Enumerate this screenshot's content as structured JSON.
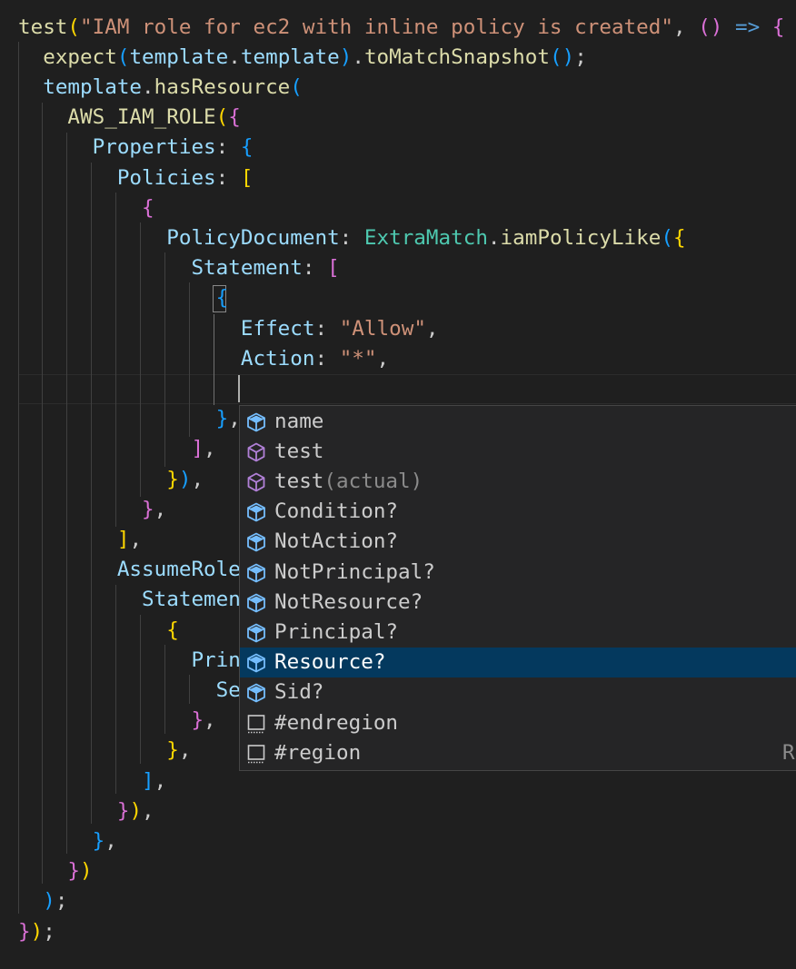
{
  "editor": {
    "lines": [
      [
        {
          "t": "test",
          "c": "fn"
        },
        {
          "t": "(",
          "c": "b1"
        },
        {
          "t": "\"IAM role for ec2 with inline policy is created\"",
          "c": "str"
        },
        {
          "t": ", ",
          "c": "pl"
        },
        {
          "t": "()",
          "c": "b2"
        },
        {
          "t": " ",
          "c": "pl"
        },
        {
          "t": "=>",
          "c": "kw"
        },
        {
          "t": " ",
          "c": "pl"
        },
        {
          "t": "{",
          "c": "b2"
        }
      ],
      [
        {
          "t": "  ",
          "c": "pl"
        },
        {
          "t": "expect",
          "c": "fn"
        },
        {
          "t": "(",
          "c": "b3"
        },
        {
          "t": "template",
          "c": "var"
        },
        {
          "t": ".",
          "c": "pl"
        },
        {
          "t": "template",
          "c": "var"
        },
        {
          "t": ")",
          "c": "b3"
        },
        {
          "t": ".",
          "c": "pl"
        },
        {
          "t": "toMatchSnapshot",
          "c": "fn"
        },
        {
          "t": "()",
          "c": "b3"
        },
        {
          "t": ";",
          "c": "pl"
        }
      ],
      [
        {
          "t": "  ",
          "c": "pl"
        },
        {
          "t": "template",
          "c": "var"
        },
        {
          "t": ".",
          "c": "pl"
        },
        {
          "t": "hasResource",
          "c": "fn"
        },
        {
          "t": "(",
          "c": "b3"
        }
      ],
      [
        {
          "t": "    ",
          "c": "pl"
        },
        {
          "t": "AWS_IAM_ROLE",
          "c": "fn"
        },
        {
          "t": "(",
          "c": "b1"
        },
        {
          "t": "{",
          "c": "b2"
        }
      ],
      [
        {
          "t": "      ",
          "c": "pl"
        },
        {
          "t": "Properties",
          "c": "prop"
        },
        {
          "t": ": ",
          "c": "pl"
        },
        {
          "t": "{",
          "c": "b3"
        }
      ],
      [
        {
          "t": "        ",
          "c": "pl"
        },
        {
          "t": "Policies",
          "c": "prop"
        },
        {
          "t": ": ",
          "c": "pl"
        },
        {
          "t": "[",
          "c": "b1"
        }
      ],
      [
        {
          "t": "          ",
          "c": "pl"
        },
        {
          "t": "{",
          "c": "b2"
        }
      ],
      [
        {
          "t": "            ",
          "c": "pl"
        },
        {
          "t": "PolicyDocument",
          "c": "prop"
        },
        {
          "t": ": ",
          "c": "pl"
        },
        {
          "t": "ExtraMatch",
          "c": "cls"
        },
        {
          "t": ".",
          "c": "pl"
        },
        {
          "t": "iamPolicyLike",
          "c": "fn"
        },
        {
          "t": "(",
          "c": "b3"
        },
        {
          "t": "{",
          "c": "b1"
        }
      ],
      [
        {
          "t": "              ",
          "c": "pl"
        },
        {
          "t": "Statement",
          "c": "prop"
        },
        {
          "t": ": ",
          "c": "pl"
        },
        {
          "t": "[",
          "c": "b2"
        }
      ],
      [
        {
          "t": "                ",
          "c": "pl"
        },
        {
          "t": "{",
          "c": "b3"
        }
      ],
      [
        {
          "t": "                  ",
          "c": "pl"
        },
        {
          "t": "Effect",
          "c": "prop"
        },
        {
          "t": ": ",
          "c": "pl"
        },
        {
          "t": "\"Allow\"",
          "c": "str"
        },
        {
          "t": ",",
          "c": "pl"
        }
      ],
      [
        {
          "t": "                  ",
          "c": "pl"
        },
        {
          "t": "Action",
          "c": "prop"
        },
        {
          "t": ": ",
          "c": "pl"
        },
        {
          "t": "\"*\"",
          "c": "str"
        },
        {
          "t": ",",
          "c": "pl"
        }
      ],
      [
        {
          "t": "",
          "c": "pl"
        }
      ],
      [
        {
          "t": "                ",
          "c": "pl"
        },
        {
          "t": "}",
          "c": "b3"
        },
        {
          "t": ",",
          "c": "pl"
        }
      ],
      [
        {
          "t": "              ",
          "c": "pl"
        },
        {
          "t": "]",
          "c": "b2"
        },
        {
          "t": ",",
          "c": "pl"
        }
      ],
      [
        {
          "t": "            ",
          "c": "pl"
        },
        {
          "t": "}",
          "c": "b1"
        },
        {
          "t": ")",
          "c": "b3"
        },
        {
          "t": ",",
          "c": "pl"
        }
      ],
      [
        {
          "t": "          ",
          "c": "pl"
        },
        {
          "t": "}",
          "c": "b2"
        },
        {
          "t": ",",
          "c": "pl"
        }
      ],
      [
        {
          "t": "        ",
          "c": "pl"
        },
        {
          "t": "]",
          "c": "b1"
        },
        {
          "t": ",",
          "c": "pl"
        }
      ],
      [
        {
          "t": "        ",
          "c": "pl"
        },
        {
          "t": "AssumeRole",
          "c": "prop"
        }
      ],
      [
        {
          "t": "          ",
          "c": "pl"
        },
        {
          "t": "Statemen",
          "c": "prop"
        }
      ],
      [
        {
          "t": "            ",
          "c": "pl"
        },
        {
          "t": "{",
          "c": "b1"
        }
      ],
      [
        {
          "t": "              ",
          "c": "pl"
        },
        {
          "t": "Prin",
          "c": "prop"
        }
      ],
      [
        {
          "t": "                ",
          "c": "pl"
        },
        {
          "t": "Se",
          "c": "prop"
        }
      ],
      [
        {
          "t": "              ",
          "c": "pl"
        },
        {
          "t": "}",
          "c": "b2"
        },
        {
          "t": ",",
          "c": "pl"
        }
      ],
      [
        {
          "t": "            ",
          "c": "pl"
        },
        {
          "t": "}",
          "c": "b1"
        },
        {
          "t": ",",
          "c": "pl"
        }
      ],
      [
        {
          "t": "          ",
          "c": "pl"
        },
        {
          "t": "]",
          "c": "b3"
        },
        {
          "t": ",",
          "c": "pl"
        }
      ],
      [
        {
          "t": "        ",
          "c": "pl"
        },
        {
          "t": "}",
          "c": "b2"
        },
        {
          "t": ")",
          "c": "b1"
        },
        {
          "t": ",",
          "c": "pl"
        }
      ],
      [
        {
          "t": "      ",
          "c": "pl"
        },
        {
          "t": "}",
          "c": "b3"
        },
        {
          "t": ",",
          "c": "pl"
        }
      ],
      [
        {
          "t": "    ",
          "c": "pl"
        },
        {
          "t": "}",
          "c": "b2"
        },
        {
          "t": ")",
          "c": "b1"
        }
      ],
      [
        {
          "t": "  ",
          "c": "pl"
        },
        {
          "t": ")",
          "c": "b3"
        },
        {
          "t": ";",
          "c": "pl"
        }
      ],
      [
        {
          "t": "}",
          "c": "b2"
        },
        {
          "t": ")",
          "c": "b1"
        },
        {
          "t": ";",
          "c": "pl"
        }
      ]
    ],
    "colors": {
      "background": "#1f1f1f",
      "function": "#dcdcaa",
      "string": "#ce9178",
      "property": "#9cdcfe",
      "class": "#4ec9b0",
      "keyword": "#569cd6",
      "bracket_gold": "#ffd700",
      "bracket_orchid": "#da70d6",
      "bracket_blue": "#179fff"
    }
  },
  "suggest": {
    "items": [
      {
        "label": "name",
        "detail": "",
        "icon": "field-icon",
        "selected": false
      },
      {
        "label": "test",
        "detail": "",
        "icon": "method-icon",
        "selected": false
      },
      {
        "label": "test",
        "detail": "(actual)",
        "icon": "method-icon",
        "selected": false
      },
      {
        "label": "Condition?",
        "detail": "",
        "icon": "field-icon",
        "selected": false
      },
      {
        "label": "NotAction?",
        "detail": "",
        "icon": "field-icon",
        "selected": false
      },
      {
        "label": "NotPrincipal?",
        "detail": "",
        "icon": "field-icon",
        "selected": false
      },
      {
        "label": "NotResource?",
        "detail": "",
        "icon": "field-icon",
        "selected": false
      },
      {
        "label": "Principal?",
        "detail": "",
        "icon": "field-icon",
        "selected": false
      },
      {
        "label": "Resource?",
        "detail": "",
        "icon": "field-icon",
        "selected": true
      },
      {
        "label": "Sid?",
        "detail": "",
        "icon": "field-icon",
        "selected": false
      },
      {
        "label": "#endregion",
        "detail": "",
        "icon": "snippet-icon",
        "selected": false
      },
      {
        "label": "#region",
        "detail": "",
        "icon": "snippet-icon",
        "selected": false,
        "right": "Re"
      }
    ],
    "colors": {
      "background": "#252526",
      "selected_background": "#04395e",
      "field_icon": "#75beff",
      "method_icon": "#b180d7",
      "snippet_icon": "#cccccc"
    }
  }
}
